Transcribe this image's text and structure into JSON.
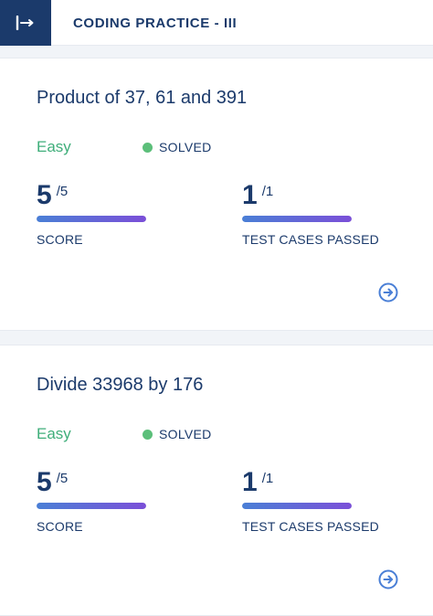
{
  "header": {
    "title": "CODING PRACTICE - III",
    "icon": "expand-sidebar-icon"
  },
  "colors": {
    "primary": "#1b3a6b",
    "easy": "#3fae7a",
    "solved_dot": "#5cbf7a",
    "progress_start": "#4a7fd6",
    "progress_end": "#7b4fd8"
  },
  "cards": [
    {
      "title": "Product of 37, 61 and 391",
      "difficulty": "Easy",
      "status": "SOLVED",
      "score": {
        "value": "5",
        "total": "/5",
        "label": "SCORE",
        "progress": 1.0
      },
      "tests": {
        "value": "1",
        "total": "/1",
        "label": "TEST CASES PASSED",
        "progress": 1.0
      },
      "action_icon": "arrow-circle-right-icon"
    },
    {
      "title": "Divide 33968 by 176",
      "difficulty": "Easy",
      "status": "SOLVED",
      "score": {
        "value": "5",
        "total": "/5",
        "label": "SCORE",
        "progress": 1.0
      },
      "tests": {
        "value": "1",
        "total": "/1",
        "label": "TEST CASES PASSED",
        "progress": 1.0
      },
      "action_icon": "arrow-circle-right-icon"
    }
  ]
}
